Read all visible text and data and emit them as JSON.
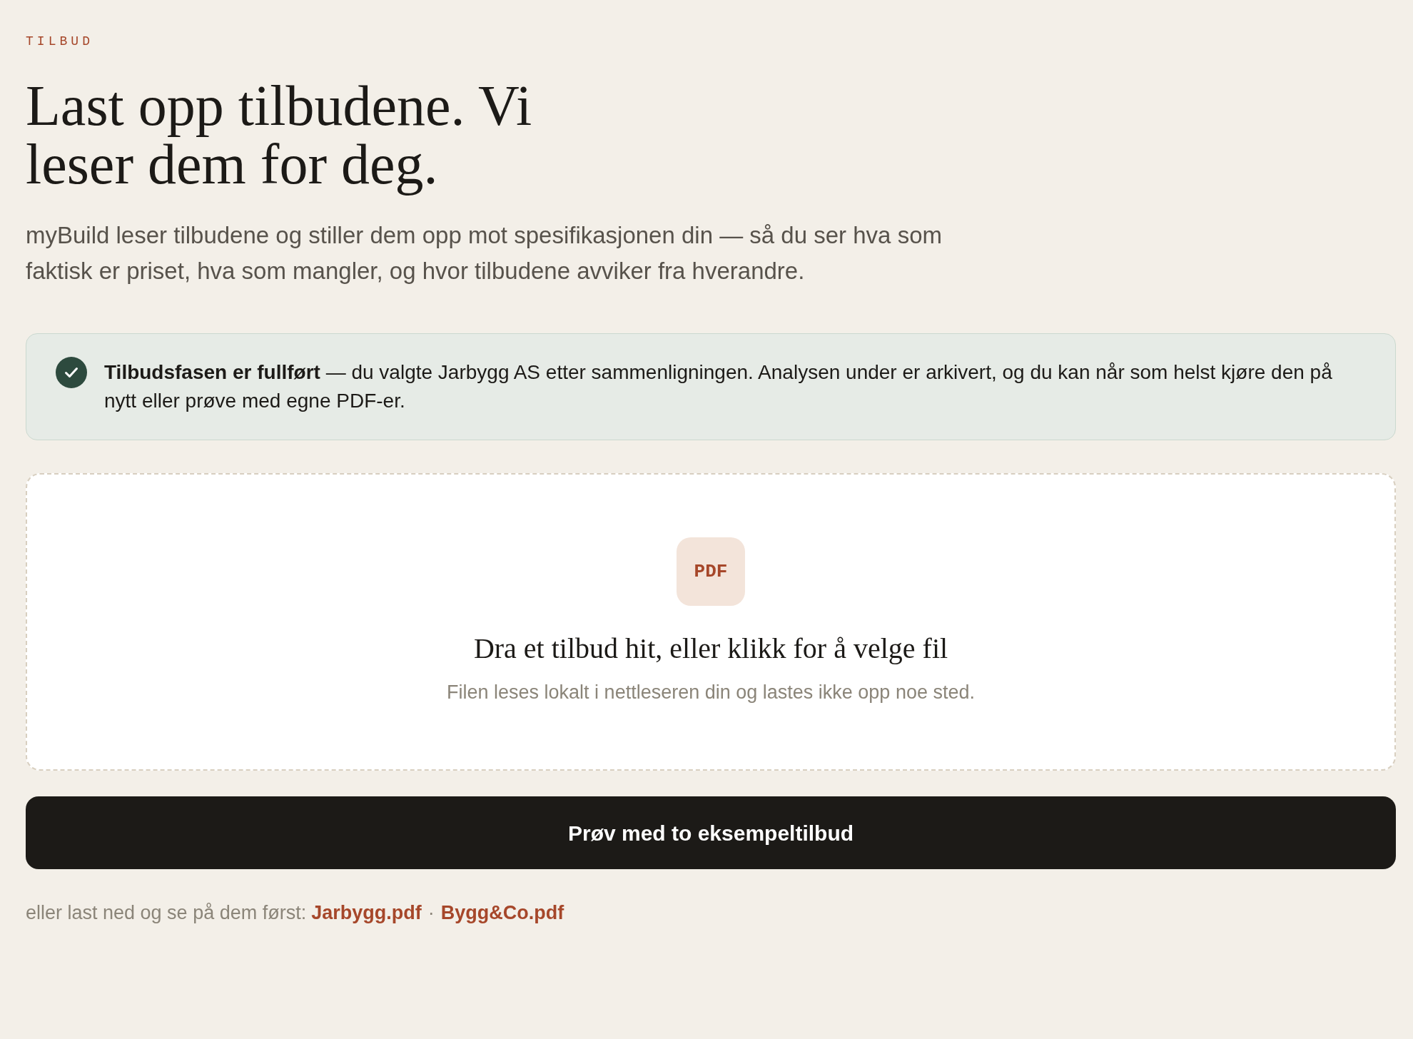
{
  "eyebrow": "TILBUD",
  "heading": "Last opp tilbudene. Vi leser dem for deg.",
  "intro": "myBuild leser tilbudene og stiller dem opp mot spesifikasjonen din — så du ser hva som faktisk er priset, hva som mangler, og hvor tilbudene avviker fra hverandre.",
  "notice": {
    "text": "**Tilbudsfasen er fullført** — du valgte Jarbygg AS etter sammenligningen. Analysen under er arkivert, og du kan når som helst kjøre den på nytt eller prøve med egne PDF-er."
  },
  "dropzone": {
    "file_type": "PDF",
    "title": "Dra et tilbud hit, eller klikk for å velge fil",
    "hint": "Filen leses lokalt i nettleseren din og lastes ikke opp noe sted."
  },
  "sample_button": "Prøv med to eksempeltilbud",
  "downloads": {
    "label": "eller last ned og se på dem først:",
    "links": [
      "Jarbygg.pdf",
      "Bygg&Co.pdf"
    ],
    "separator": "·"
  }
}
